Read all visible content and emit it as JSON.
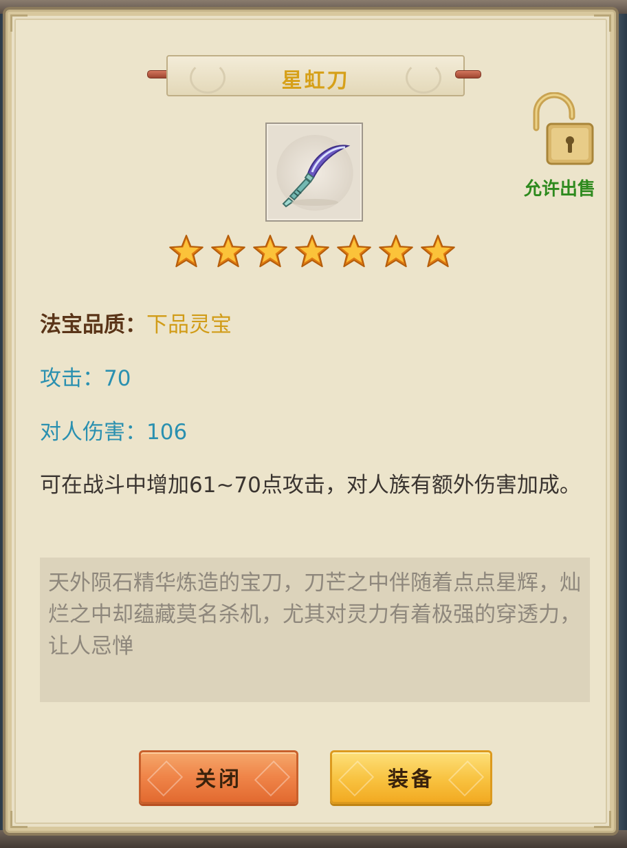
{
  "dialog": {
    "title": "星虹刀",
    "sell_status": "允许出售",
    "item_icon": "curved-dagger-icon",
    "star_rating": 7,
    "quality": {
      "label": "法宝品质：",
      "value": "下品灵宝"
    },
    "attack": "攻击：70",
    "pvp_damage": "对人伤害：106",
    "effect": "可在战斗中增加61~70点攻击，对人族有额外伤害加成。",
    "description": "天外陨石精华炼造的宝刀，刀芒之中伴随着点点星辉，灿烂之中却蕴藏莫名杀机，尤其对灵力有着极强的穿透力，让人忌惮",
    "buttons": {
      "close": "关闭",
      "equip": "装备"
    }
  },
  "colors": {
    "title": "#d6a019",
    "quality_label": "#5a3418",
    "quality_value": "#d19c18",
    "stat": "#2a90b0",
    "sell": "#2e8a1e",
    "close_button": "#ef8448",
    "equip_button": "#f8c240"
  }
}
